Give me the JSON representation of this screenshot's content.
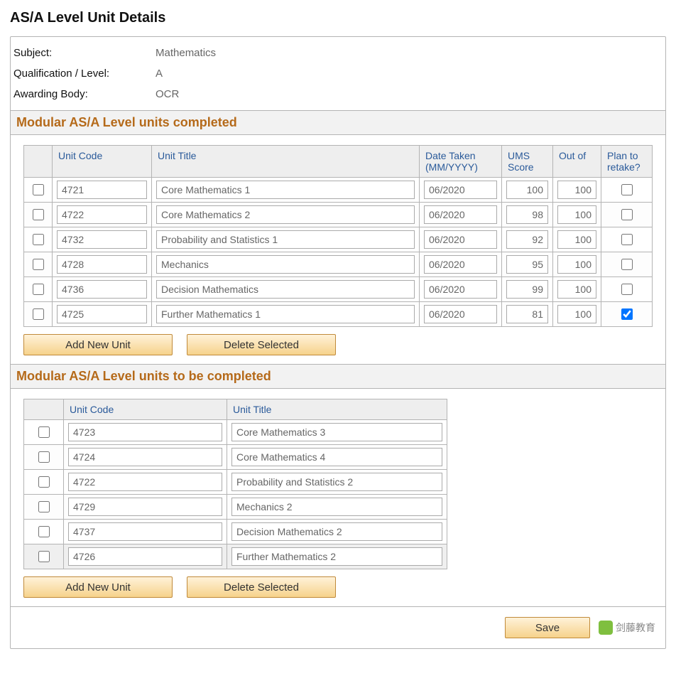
{
  "heading": "AS/A Level Unit Details",
  "header": {
    "subject_label": "Subject:",
    "subject_value": "Mathematics",
    "qual_label": "Qualification / Level:",
    "qual_value": "A",
    "body_label": "Awarding Body:",
    "body_value": "OCR"
  },
  "section_completed": {
    "title": "Modular AS/A Level units completed",
    "cols": {
      "code": "Unit Code",
      "title": "Unit Title",
      "date": "Date Taken (MM/YYYY)",
      "ums": "UMS Score",
      "out": "Out of",
      "retake": "Plan to retake?"
    },
    "rows": [
      {
        "code": "4721",
        "title": "Core Mathematics 1",
        "date": "06/2020",
        "ums": "100",
        "out": "100",
        "retake": false
      },
      {
        "code": "4722",
        "title": "Core Mathematics 2",
        "date": "06/2020",
        "ums": "98",
        "out": "100",
        "retake": false
      },
      {
        "code": "4732",
        "title": "Probability and Statistics 1",
        "date": "06/2020",
        "ums": "92",
        "out": "100",
        "retake": false
      },
      {
        "code": "4728",
        "title": "Mechanics",
        "date": "06/2020",
        "ums": "95",
        "out": "100",
        "retake": false
      },
      {
        "code": "4736",
        "title": "Decision Mathematics",
        "date": "06/2020",
        "ums": "99",
        "out": "100",
        "retake": false
      },
      {
        "code": "4725",
        "title": "Further Mathematics 1",
        "date": "06/2020",
        "ums": "81",
        "out": "100",
        "retake": true
      }
    ],
    "add_label": "Add New Unit",
    "delete_label": "Delete Selected"
  },
  "section_todo": {
    "title": "Modular AS/A Level units to be completed",
    "cols": {
      "code": "Unit Code",
      "title": "Unit Title"
    },
    "rows": [
      {
        "code": "4723",
        "title": "Core Mathematics 3"
      },
      {
        "code": "4724",
        "title": "Core Mathematics 4"
      },
      {
        "code": "4722",
        "title": "Probability and Statistics 2"
      },
      {
        "code": "4729",
        "title": "Mechanics 2"
      },
      {
        "code": "4737",
        "title": "Decision Mathematics 2"
      },
      {
        "code": "4726",
        "title": "Further Mathematics 2",
        "selected": true
      }
    ],
    "add_label": "Add New Unit",
    "delete_label": "Delete Selected"
  },
  "footer": {
    "save": "Save",
    "watermark": "剑藤教育"
  }
}
